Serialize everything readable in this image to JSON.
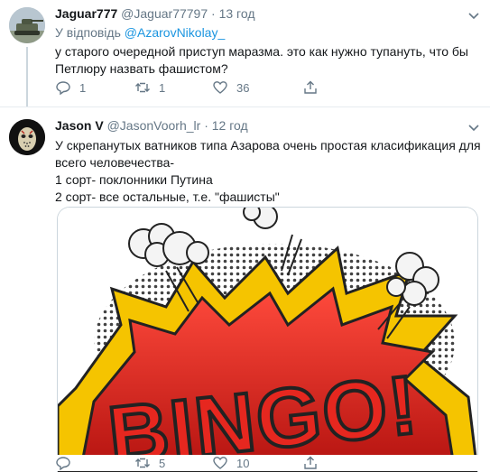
{
  "tweet1": {
    "name": "Jaguar777",
    "handle": "@Jaguar77797",
    "dot": "·",
    "time": "13 год",
    "reply_prefix": "У відповідь",
    "reply_handle": "@AzarovNikolay_",
    "text_lines": [
      "у старого очередной приступ маразма. это как нужно тупануть, что бы",
      "Петлюру назвать фашистом?"
    ],
    "replies": "1",
    "retweets": "1",
    "likes": "36"
  },
  "tweet2": {
    "name": "Jason V",
    "handle": "@JasonVoorh_lr",
    "dot": "·",
    "time": "12 год",
    "text_lines": [
      "У скрепанутых ватников типа Азарова очень простая класификация для",
      "всего человечества-",
      "1 сорт- поклонники Путина",
      "2 сорт- все остальные, т.е. \"фашисты\""
    ],
    "image_text": "BINGO!",
    "replies": "",
    "retweets": "5",
    "likes": "10"
  },
  "colors": {
    "text": "#14171a",
    "secondary": "#657786",
    "link": "#1b95e0",
    "thread_line": "#ccd6dd",
    "bingo_red": "#d8231f",
    "bingo_yellow": "#f5c400"
  }
}
